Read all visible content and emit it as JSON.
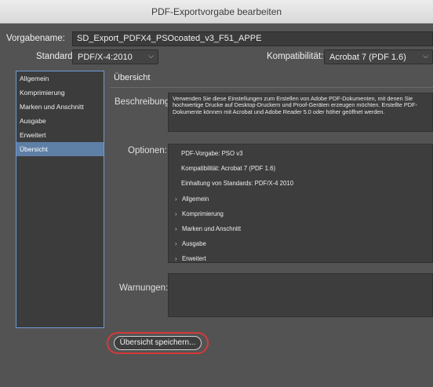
{
  "window": {
    "title": "PDF-Exportvorgabe bearbeiten"
  },
  "header": {
    "preset_label": "Vorgabename:",
    "preset_value": "SD_Export_PDFX4_PSOcoated_v3_F51_APPE",
    "standard_label": "Standard:",
    "standard_value": "PDF/X-4:2010",
    "compat_label": "Kompatibilität:",
    "compat_value": "Acrobat 7 (PDF 1.6)"
  },
  "sidebar": {
    "items": [
      {
        "label": "Allgemein"
      },
      {
        "label": "Komprimierung"
      },
      {
        "label": "Marken und Anschnitt"
      },
      {
        "label": "Ausgabe"
      },
      {
        "label": "Erweitert"
      },
      {
        "label": "Übersicht"
      }
    ],
    "selected": "Übersicht"
  },
  "main": {
    "section_title": "Übersicht",
    "description_label": "Beschreibung:",
    "description_text": "Verwenden Sie diese Einstellungen zum Erstellen von Adobe PDF-Dokumenten, mit denen Sie hochwertige Drucke auf Desktop-Druckern und Proof-Geräten erzeugen möchten. Erstellte PDF-Dokumente können mit Acrobat und Adobe Reader 5.0 oder höher geöffnet werden.",
    "options_label": "Optionen:",
    "options_lines": [
      "PDF-Vorgabe: PSO v3",
      "Kompatibilität: Acrobat 7 (PDF 1.6)",
      "Einhaltung von Standards: PDF/X-4 2010"
    ],
    "options_tree": [
      "Allgemein",
      "Komprimierung",
      "Marken und Anschnitt",
      "Ausgabe",
      "Erweitert"
    ],
    "warnings_label": "Warnungen:"
  },
  "footer": {
    "save_summary_label": "Übersicht speichern..."
  }
}
